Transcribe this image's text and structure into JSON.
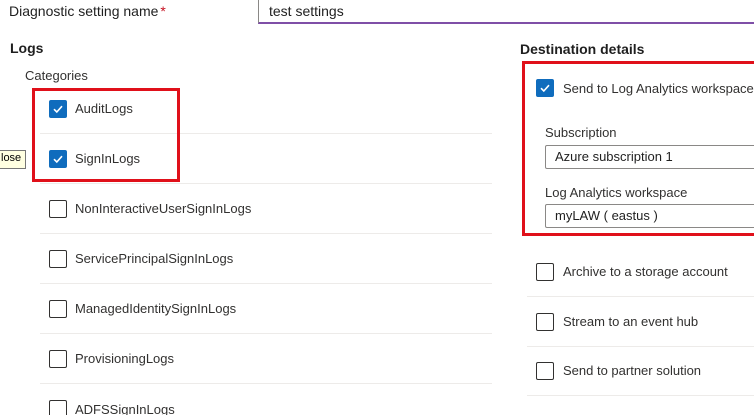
{
  "setting": {
    "label": "Diagnostic setting name",
    "required_marker": "*",
    "value": "test settings"
  },
  "logs": {
    "title": "Logs",
    "categories_label": "Categories",
    "categories": [
      {
        "label": "AuditLogs",
        "checked": true
      },
      {
        "label": "SignInLogs",
        "checked": true
      },
      {
        "label": "NonInteractiveUserSignInLogs",
        "checked": false
      },
      {
        "label": "ServicePrincipalSignInLogs",
        "checked": false
      },
      {
        "label": "ManagedIdentitySignInLogs",
        "checked": false
      },
      {
        "label": "ProvisioningLogs",
        "checked": false
      },
      {
        "label": "ADFSSignInLogs",
        "checked": false
      }
    ]
  },
  "tooltip": {
    "text": "lose"
  },
  "destination": {
    "title": "Destination details",
    "log_analytics": {
      "label": "Send to Log Analytics workspace",
      "checked": true
    },
    "subscription": {
      "label": "Subscription",
      "value": "Azure subscription 1"
    },
    "workspace": {
      "label": "Log Analytics workspace",
      "value": "myLAW ( eastus )"
    },
    "options": [
      {
        "label": "Archive to a storage account",
        "checked": false
      },
      {
        "label": "Stream to an event hub",
        "checked": false
      },
      {
        "label": "Send to partner solution",
        "checked": false
      }
    ]
  },
  "colors": {
    "accent": "#0f6cbd",
    "highlight": "#e0101a",
    "input_focus": "#7f4fa7",
    "required": "#c50f1f"
  },
  "icons": {
    "checkmark": "checkmark-icon"
  }
}
